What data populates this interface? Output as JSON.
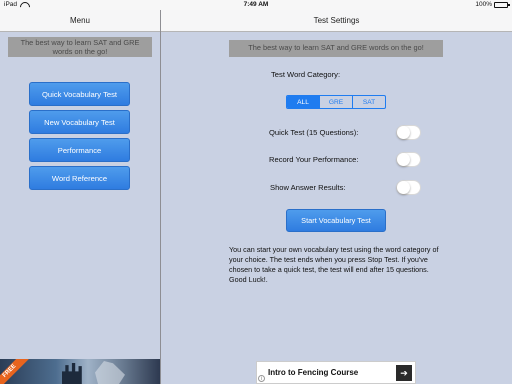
{
  "status_bar": {
    "device": "iPad",
    "time": "7:49 AM",
    "battery": "100%"
  },
  "menu_nav": {
    "title": "Menu"
  },
  "settings_nav": {
    "title": "Test Settings"
  },
  "tagline": "The best way to learn SAT and GRE words on the go!",
  "menu": {
    "items": [
      {
        "label": "Quick Vocabulary Test"
      },
      {
        "label": "New Vocabulary Test"
      },
      {
        "label": "Performance"
      },
      {
        "label": "Word Reference"
      }
    ]
  },
  "settings": {
    "category_label": "Test Word Category:",
    "categories": [
      "ALL",
      "GRE",
      "SAT"
    ],
    "selected_category": "ALL",
    "quick_test_label": "Quick Test (15 Questions):",
    "quick_test_on": false,
    "record_label": "Record Your Performance:",
    "record_on": false,
    "show_answers_label": "Show Answer Results:",
    "show_answers_on": false,
    "start_label": "Start Vocabulary Test",
    "description": "You can start your own vocabulary test using the word category of your choice. The test ends when you press Stop Test. If you've chosen to take a quick test, the test will end after 15 questions. Good Luck!."
  },
  "ads": {
    "left_badge": "FREE",
    "right_title": "Intro to Fencing Course"
  },
  "colors": {
    "accent": "#1f7cf0",
    "button": "#3a86e6",
    "background": "#c9d1e3"
  }
}
